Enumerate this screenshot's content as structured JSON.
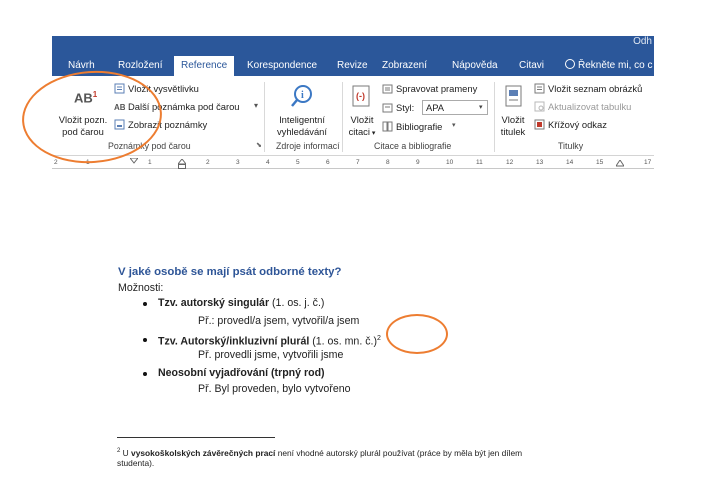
{
  "window": {
    "user_label": "Odh"
  },
  "tabs": [
    {
      "label": "Návrh",
      "active": false
    },
    {
      "label": "Rozložení",
      "active": false
    },
    {
      "label": "Reference",
      "active": true
    },
    {
      "label": "Korespondence",
      "active": false
    },
    {
      "label": "Revize",
      "active": false
    },
    {
      "label": "Zobrazení",
      "active": false
    },
    {
      "label": "Nápověda",
      "active": false
    },
    {
      "label": "Citavi",
      "active": false
    }
  ],
  "tell_me": {
    "label": "Řekněte mi, co c"
  },
  "ribbon": {
    "footnotes": {
      "insert_footnote_line1": "Vložit pozn.",
      "insert_footnote_line2": "pod čarou",
      "big_icon_text": "AB",
      "big_icon_sup": "1",
      "insert_endnote": "Vložit vysvětlivku",
      "next_footnote": "Další poznámka pod čarou",
      "show_notes": "Zobrazit poznámky",
      "group_label": "Poznámky pod čarou"
    },
    "research": {
      "smart_lookup_line1": "Inteligentní",
      "smart_lookup_line2": "vyhledávání",
      "group_label": "Zdroje informací"
    },
    "citations": {
      "insert_citation_line1": "Vložit",
      "insert_citation_line2": "citaci",
      "manage_sources": "Spravovat prameny",
      "style_label": "Styl:",
      "style_value": "APA",
      "bibliography": "Bibliografie",
      "group_label": "Citace a bibliografie"
    },
    "captions": {
      "insert_caption_line1": "Vložit",
      "insert_caption_line2": "titulek",
      "insert_table_of_figures": "Vložit seznam obrázků",
      "update_table": "Aktualizovat tabulku",
      "cross_reference": "Křížový odkaz",
      "group_label": "Titulky"
    }
  },
  "ruler": {
    "labels": [
      "2",
      "1",
      "1",
      "2",
      "3",
      "4",
      "5",
      "6",
      "7",
      "8",
      "9",
      "10",
      "11",
      "12",
      "13",
      "14",
      "15",
      "17"
    ]
  },
  "document": {
    "heading": "V jaké osobě se mají psát odborné texty?",
    "intro": "Možnosti:",
    "items": [
      {
        "title": "Tzv. autorský singulár",
        "suffix": " (1. os. j. č.)",
        "example": "Př.: provedl/a jsem, vytvořil/a jsem"
      },
      {
        "title": "Tzv. Autorský/inkluzivní plurál",
        "suffix": " (1. os. mn. č.)",
        "marker": "2",
        "example": "Př. provedli jsme, vytvořili jsme"
      },
      {
        "title": "Neosobní vyjadřování (trpný rod)",
        "suffix": "",
        "example": "Př. Byl proveden, bylo vytvořeno"
      }
    ],
    "footnote": {
      "number": "2",
      "pre": " U ",
      "bold": "vysokoškolských závěrečných prací",
      "post": " není vhodné autorský plurál používat (práce by měla být jen dílem",
      "line2": "studenta)."
    }
  },
  "colors": {
    "ribbon_blue": "#2b579a",
    "heading_blue": "#2e5597",
    "annotation_orange": "#ed7d31"
  }
}
